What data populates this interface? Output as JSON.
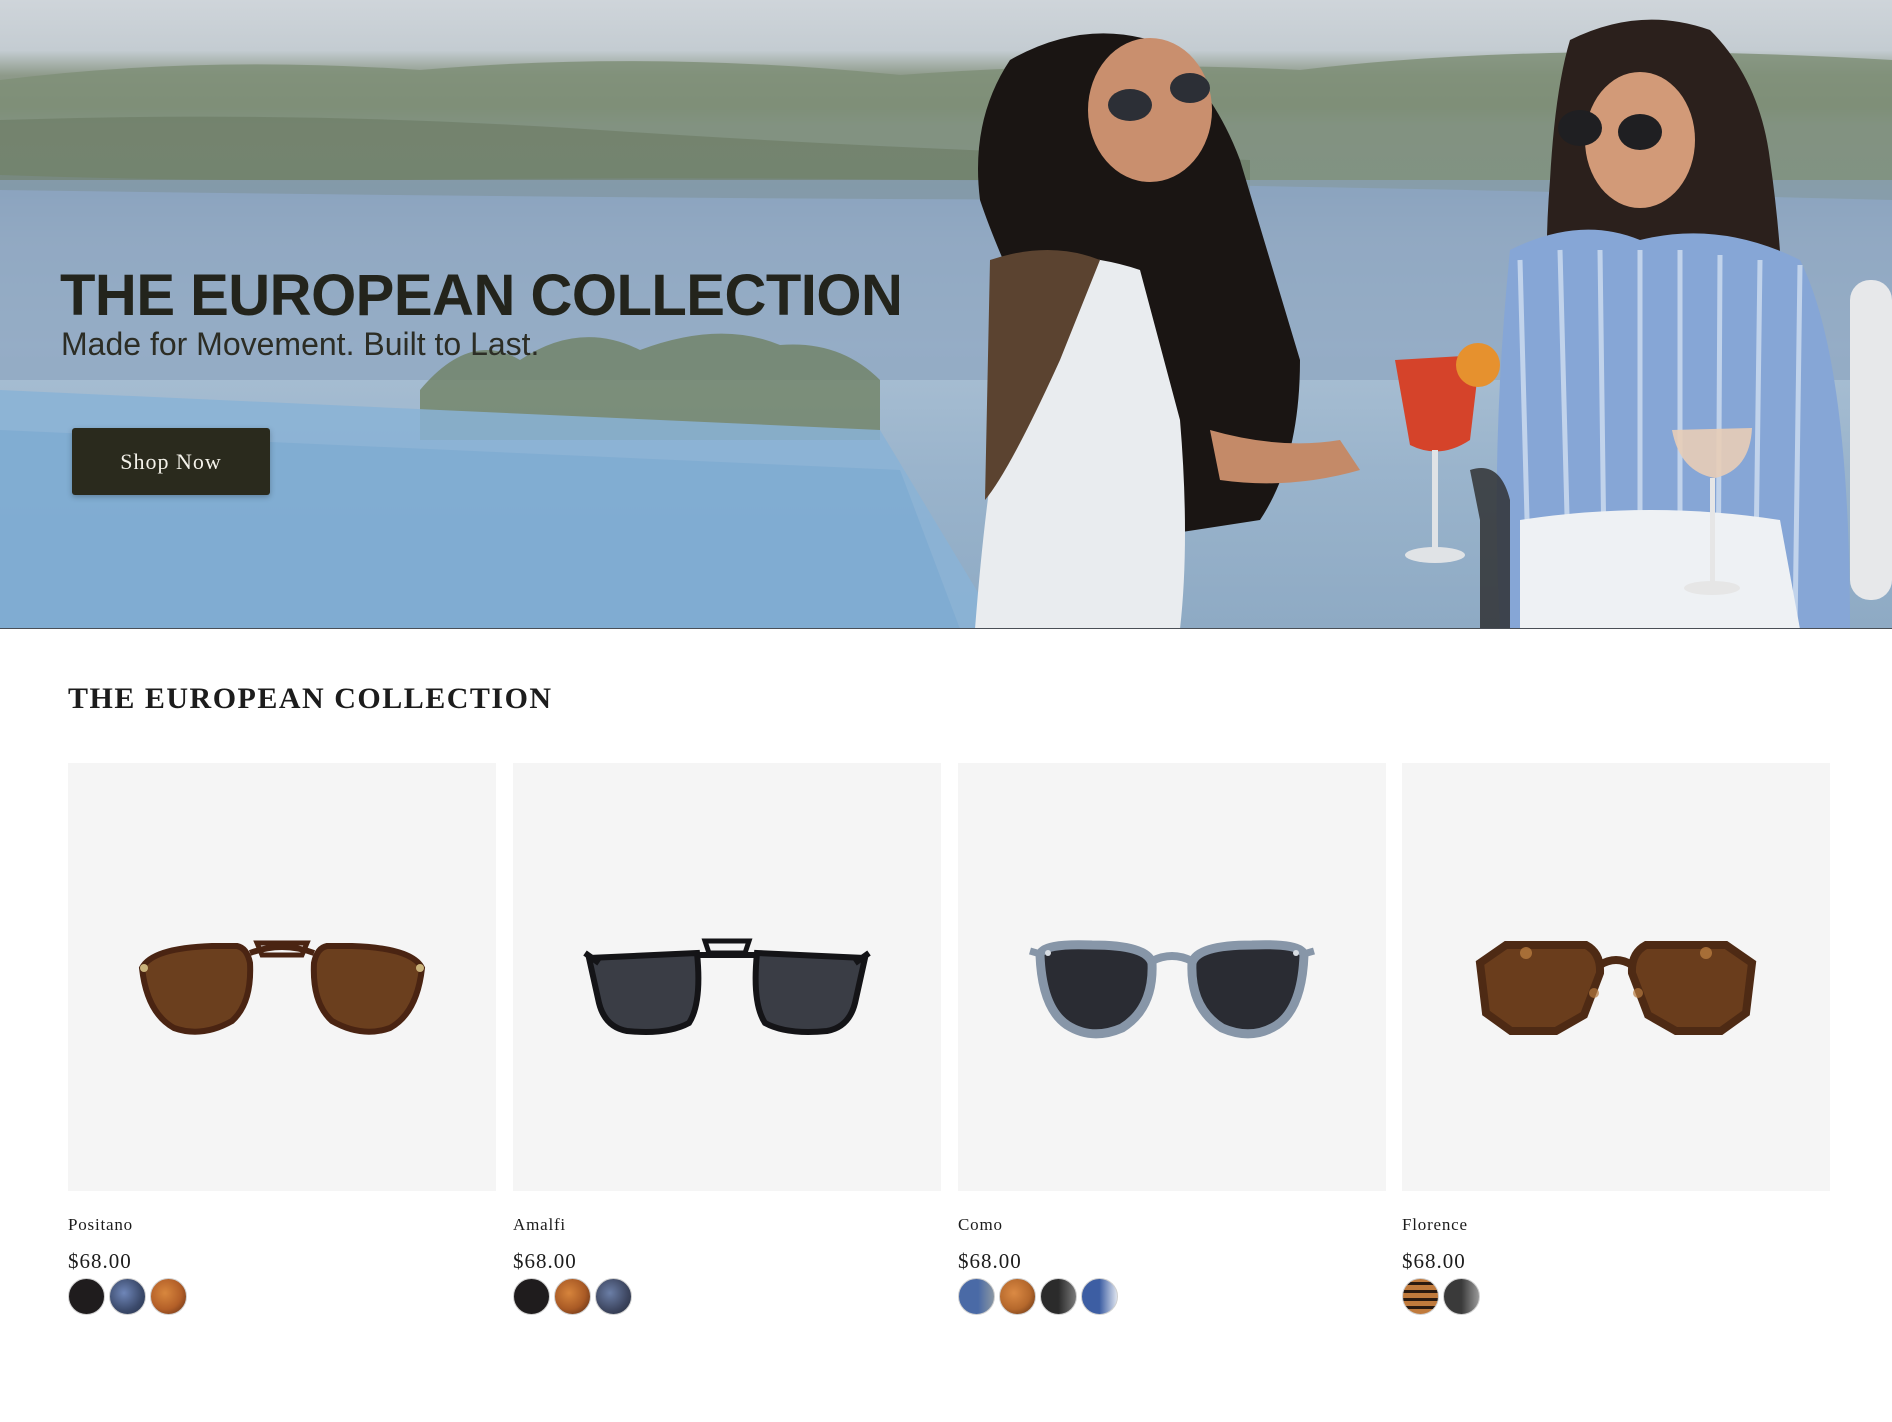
{
  "hero": {
    "title": "THE EUROPEAN COLLECTION",
    "subtitle": "Made for Movement. Built to Last.",
    "cta_label": "Shop Now"
  },
  "section": {
    "title": "THE EUROPEAN COLLECTION"
  },
  "products": [
    {
      "name": "Positano",
      "price": "$68.00",
      "frame": "aviator",
      "frame_color": "#5a2e18",
      "lens_color": "#6b3f1e",
      "swatches": [
        "#1f1c1d",
        "#3b4a6b",
        "#b35f28"
      ]
    },
    {
      "name": "Amalfi",
      "price": "$68.00",
      "frame": "navigator",
      "frame_color": "#141417",
      "lens_color": "#3a3d45",
      "swatches": [
        "#1f1c1d",
        "#a95a25",
        "#3d4660"
      ]
    },
    {
      "name": "Como",
      "price": "$68.00",
      "frame": "round",
      "frame_color": "#8796a8",
      "lens_color": "#2a2c33",
      "swatches": [
        "#4a6aa6",
        "#b5682c",
        "#2b2b2b",
        "#3d5ea3"
      ]
    },
    {
      "name": "Florence",
      "price": "$68.00",
      "frame": "geometric",
      "frame_color": "#4e2a14",
      "lens_color": "#6a3d1c",
      "swatches": [
        "#c07a3c",
        "#3a3a3a"
      ]
    }
  ]
}
